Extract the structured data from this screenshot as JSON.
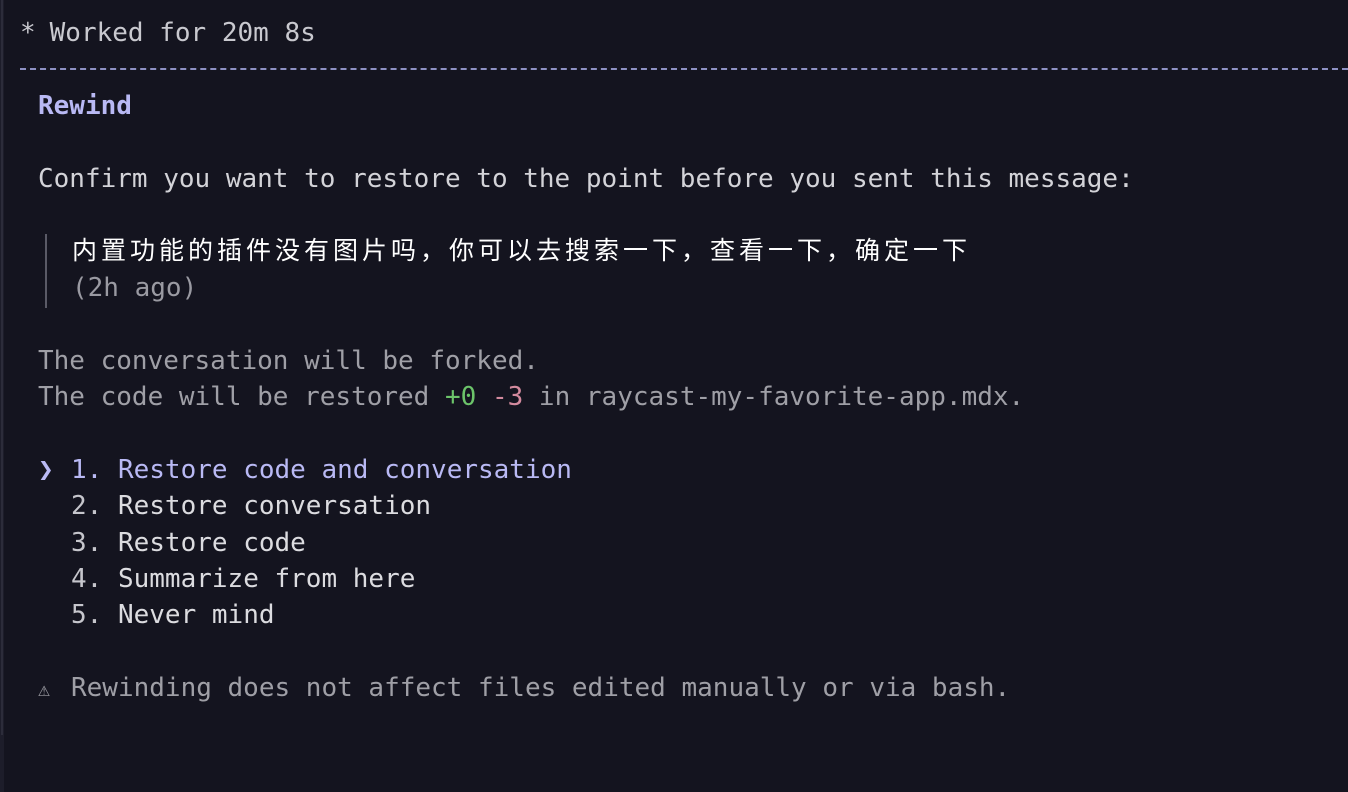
{
  "status": {
    "icon": "asterisk-icon",
    "glyph": "*",
    "text": "Worked for 20m 8s"
  },
  "dialog": {
    "title": "Rewind",
    "prompt": "Confirm you want to restore to the point before you sent this message:",
    "quote": {
      "message": "内置功能的插件没有图片吗，你可以去搜索一下，查看一下，确定一下",
      "time": "(2h ago)"
    },
    "fork_note": "The conversation will be forked.",
    "code_note": {
      "prefix": "The code will be restored ",
      "added": "+0",
      "removed": "-3",
      "suffix": " in raycast-my-favorite-app.mdx."
    },
    "cursor_glyph": "❯",
    "options": [
      {
        "num": "1.",
        "label": "Restore code and conversation",
        "selected": true
      },
      {
        "num": "2.",
        "label": "Restore conversation",
        "selected": false
      },
      {
        "num": "3.",
        "label": "Restore code",
        "selected": false
      },
      {
        "num": "4.",
        "label": "Summarize from here",
        "selected": false
      },
      {
        "num": "5.",
        "label": "Never mind",
        "selected": false
      }
    ],
    "warning": {
      "icon": "warning-icon",
      "glyph": "⚠",
      "text": "Rewinding does not affect files edited manually or via bash."
    }
  },
  "colors": {
    "accent": "#b9b9f4",
    "added": "#6cc46a",
    "removed": "#d38a9e",
    "background": "#14141f"
  }
}
